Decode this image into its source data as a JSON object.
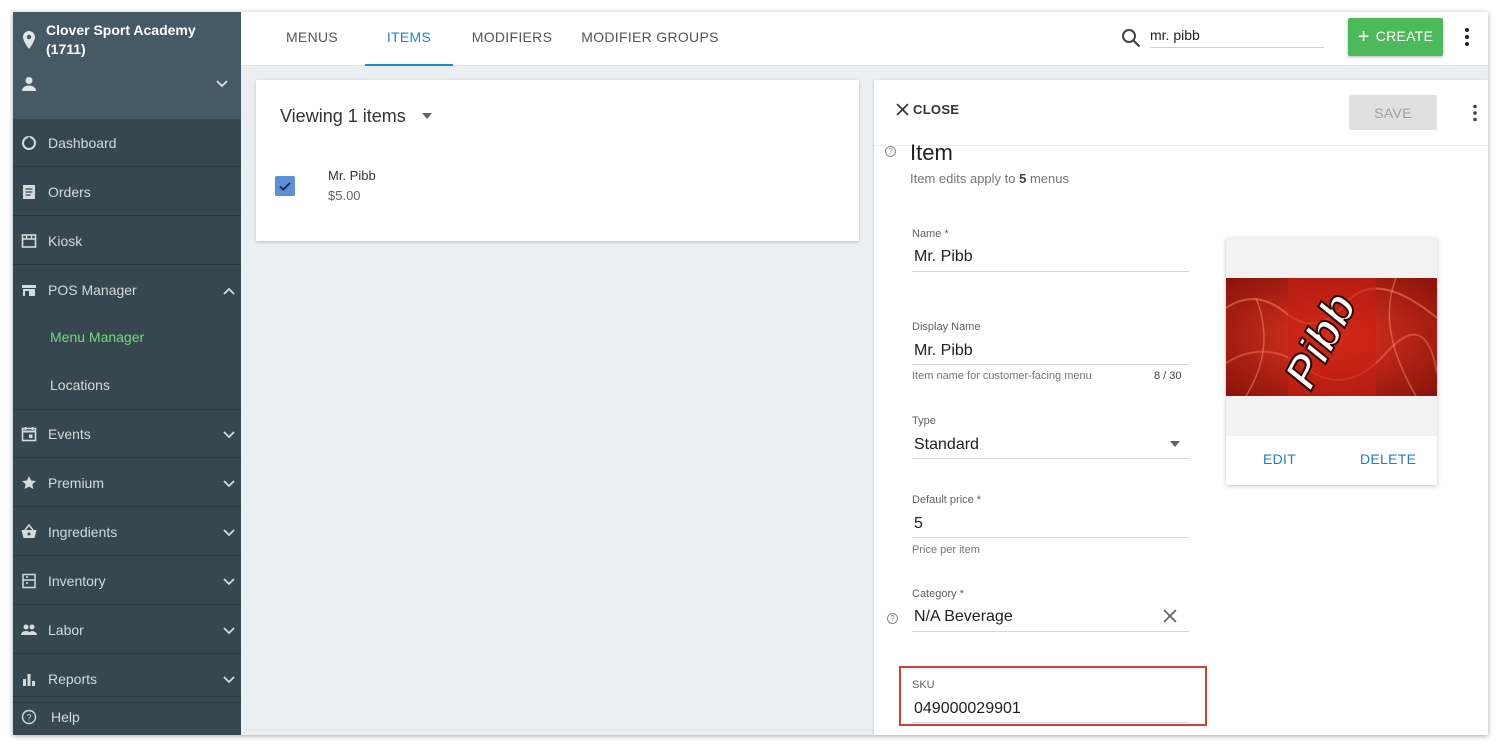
{
  "sidebar": {
    "location_name": "Clover Sport Academy (1711)",
    "items": [
      {
        "label": "Dashboard",
        "icon": "dashboard-icon"
      },
      {
        "label": "Orders",
        "icon": "orders-icon"
      },
      {
        "label": "Kiosk",
        "icon": "kiosk-icon"
      },
      {
        "label": "POS Manager",
        "icon": "store-icon",
        "expanded": true
      },
      {
        "label": "Events",
        "icon": "calendar-icon"
      },
      {
        "label": "Premium",
        "icon": "star-icon"
      },
      {
        "label": "Ingredients",
        "icon": "basket-icon"
      },
      {
        "label": "Inventory",
        "icon": "inventory-icon"
      },
      {
        "label": "Labor",
        "icon": "people-icon"
      },
      {
        "label": "Reports",
        "icon": "bar-chart-icon"
      },
      {
        "label": "Help",
        "icon": "help-icon"
      }
    ],
    "sub_items": [
      {
        "label": "Menu Manager",
        "active": true
      },
      {
        "label": "Locations",
        "active": false
      }
    ]
  },
  "topbar": {
    "tabs": [
      {
        "label": "MENUS"
      },
      {
        "label": "ITEMS",
        "active": true
      },
      {
        "label": "MODIFIERS"
      },
      {
        "label": "MODIFIER GROUPS"
      }
    ],
    "search_value": "mr. pibb",
    "create_label": "CREATE"
  },
  "list": {
    "viewing_label": "Viewing 1 items",
    "items": [
      {
        "name": "Mr. Pibb",
        "price": "$5.00",
        "checked": true
      }
    ]
  },
  "detail": {
    "close_label": "CLOSE",
    "save_label": "SAVE",
    "title": "Item",
    "subtitle_prefix": "Item edits apply to ",
    "subtitle_count": "5",
    "subtitle_suffix": " menus",
    "fields": {
      "name": {
        "label": "Name *",
        "value": "Mr. Pibb"
      },
      "display_name": {
        "label": "Display Name",
        "value": "Mr. Pibb",
        "hint": "Item name for customer-facing menu",
        "count": "8 / 30"
      },
      "type": {
        "label": "Type",
        "value": "Standard"
      },
      "default_price": {
        "label": "Default price *",
        "value": "5",
        "hint": "Price per item"
      },
      "category": {
        "label": "Category *",
        "value": "N/A Beverage"
      },
      "sku": {
        "label": "SKU",
        "value": "049000029901"
      }
    },
    "image": {
      "logo_text": "Pibb",
      "edit_label": "EDIT",
      "delete_label": "DELETE"
    }
  },
  "colors": {
    "sidebar_bg": "#37474f",
    "sidebar_header_bg": "#455a64",
    "accent_blue": "#1f88c9",
    "create_green": "#4cba5a",
    "active_nav_green": "#6fdd7a",
    "sku_highlight": "#c84433"
  }
}
